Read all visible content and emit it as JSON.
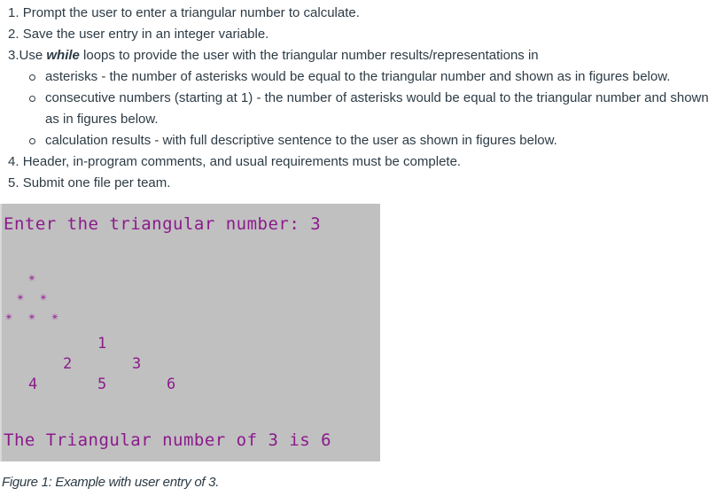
{
  "instructions": {
    "steps": [
      {
        "number": "1.",
        "text": "Prompt the user to enter a triangular number to calculate."
      },
      {
        "number": "2.",
        "text": "Save the user entry in an integer variable."
      },
      {
        "number": "3.",
        "text_before": "Use ",
        "emphasis": "while",
        "text_after": " loops to provide the user with the triangular number results/representations in",
        "subitems": [
          "asterisks - the number of asterisks would be equal to the triangular number and shown as in figures below.",
          "consecutive numbers (starting at 1) - the number of asterisks would be equal to the triangular number and shown as in figures below.",
          "calculation results - with full descriptive sentence to the user as shown in figures below."
        ]
      },
      {
        "number": "4.",
        "text": "Header, in-program comments, and usual requirements must be complete."
      },
      {
        "number": "5.",
        "text": "Submit one file per team."
      }
    ]
  },
  "console": {
    "prompt": "Enter the triangular number: 3",
    "star_glyph": "✴",
    "asterisk_rows": [
      1,
      2,
      3
    ],
    "number_rows": [
      [
        "1"
      ],
      [
        "2",
        "3"
      ],
      [
        "4",
        "5",
        "6"
      ]
    ],
    "result": "The Triangular number of 3 is 6",
    "background_color": "#c0c0c0",
    "text_color": "#8b1a8b"
  },
  "caption": "Figure 1: Example with user entry of 3."
}
